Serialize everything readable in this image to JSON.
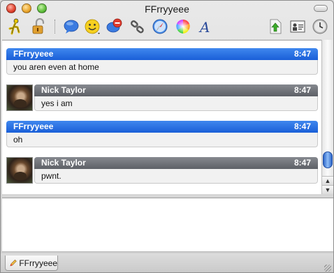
{
  "window": {
    "title": "FFrryyeee"
  },
  "toolbar": {
    "buttons": [
      {
        "name": "aim-buddy-icon"
      },
      {
        "name": "lock-icon"
      },
      {
        "name": "speech-bubble-icon"
      },
      {
        "name": "smiley-icon"
      },
      {
        "name": "block-icon"
      },
      {
        "name": "link-icon"
      },
      {
        "name": "safari-compass-icon"
      },
      {
        "name": "color-wheel-icon"
      },
      {
        "name": "font-icon"
      },
      {
        "name": "send-file-icon"
      },
      {
        "name": "buddy-info-icon"
      },
      {
        "name": "history-clock-icon"
      }
    ]
  },
  "transcript": {
    "messages": [
      {
        "sender": "FFrryyeee",
        "time": "8:47",
        "text": "you aren even at home",
        "self": true
      },
      {
        "sender": "Nick Taylor",
        "time": "8:47",
        "text": "yes i am",
        "self": false
      },
      {
        "sender": "FFrryyeee",
        "time": "8:47",
        "text": "oh",
        "self": true
      },
      {
        "sender": "Nick Taylor",
        "time": "8:47",
        "text": "pwnt.",
        "self": false
      }
    ]
  },
  "tabs": [
    {
      "label": "FFrryyeee"
    }
  ],
  "colors": {
    "self_header": "#1a5fd8",
    "other_header": "#5d6066"
  }
}
